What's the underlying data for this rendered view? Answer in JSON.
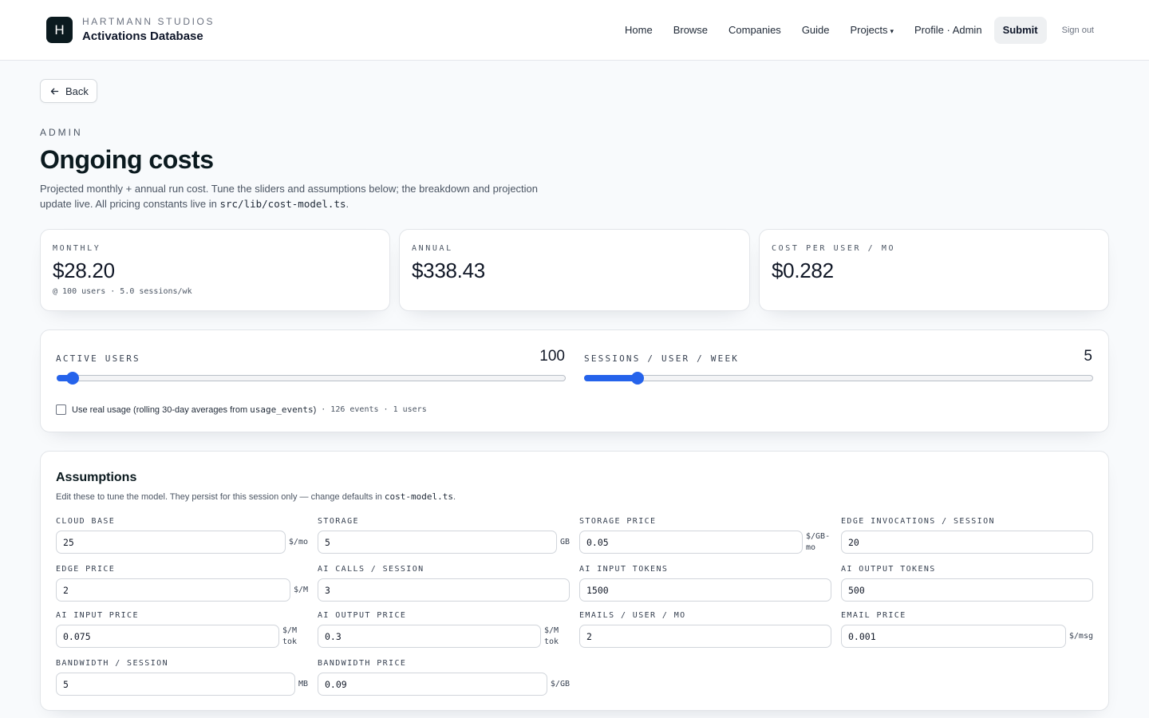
{
  "header": {
    "logo_letter": "H",
    "brand_eyebrow": "HARTMANN STUDIOS",
    "brand_title": "Activations Database",
    "nav": {
      "home": "Home",
      "browse": "Browse",
      "companies": "Companies",
      "guide": "Guide",
      "projects": "Projects",
      "projects_caret": "▾",
      "profile": "Profile · Admin",
      "submit": "Submit",
      "signout": "Sign out"
    }
  },
  "back": {
    "label": "Back"
  },
  "page": {
    "eyebrow": "ADMIN",
    "title": "Ongoing costs",
    "desc_pre": "Projected monthly + annual run cost. Tune the sliders and assumptions below; the breakdown and projection update live. All pricing constants live in ",
    "desc_code": "src/lib/cost-model.ts",
    "desc_post": "."
  },
  "stats": {
    "monthly": {
      "label": "MONTHLY",
      "value": "$28.20",
      "sub": "@ 100 users · 5.0 sessions/wk"
    },
    "annual": {
      "label": "ANNUAL",
      "value": "$338.43"
    },
    "per_user": {
      "label": "COST PER USER / MO",
      "value": "$0.282"
    }
  },
  "sliders": {
    "users": {
      "label": "ACTIVE USERS",
      "value": "100",
      "fraction": 0.017
    },
    "sessions": {
      "label": "SESSIONS / USER / WEEK",
      "value": "5",
      "fraction": 0.093
    },
    "real_usage": {
      "checked": false,
      "label_pre": "Use real usage (rolling 30-day averages from",
      "label_code": "usage_events",
      "label_post": ")",
      "meta": "· 126 events · 1 users"
    }
  },
  "assumptions": {
    "title": "Assumptions",
    "desc_pre": "Edit these to tune the model. They persist for this session only — change defaults in ",
    "desc_code": "cost-model.ts",
    "desc_post": ".",
    "fields": [
      {
        "label": "CLOUD BASE",
        "value": "25",
        "unit": "$/mo"
      },
      {
        "label": "STORAGE",
        "value": "5",
        "unit": "GB"
      },
      {
        "label": "STORAGE PRICE",
        "value": "0.05",
        "unit": "$/GB-mo"
      },
      {
        "label": "EDGE INVOCATIONS / SESSION",
        "value": "20",
        "unit": ""
      },
      {
        "label": "EDGE PRICE",
        "value": "2",
        "unit": "$/M"
      },
      {
        "label": "AI CALLS / SESSION",
        "value": "3",
        "unit": ""
      },
      {
        "label": "AI INPUT TOKENS",
        "value": "1500",
        "unit": ""
      },
      {
        "label": "AI OUTPUT TOKENS",
        "value": "500",
        "unit": ""
      },
      {
        "label": "AI INPUT PRICE",
        "value": "0.075",
        "unit": "$/M tok"
      },
      {
        "label": "AI OUTPUT PRICE",
        "value": "0.3",
        "unit": "$/M tok"
      },
      {
        "label": "EMAILS / USER / MO",
        "value": "2",
        "unit": ""
      },
      {
        "label": "EMAIL PRICE",
        "value": "0.001",
        "unit": "$/msg"
      },
      {
        "label": "BANDWIDTH / SESSION",
        "value": "5",
        "unit": "MB"
      },
      {
        "label": "BANDWIDTH PRICE",
        "value": "0.09",
        "unit": "$/GB"
      }
    ]
  },
  "colors": {
    "accent": "#2563eb",
    "logo_bg": "#0b1a1f",
    "page_bg": "#f8fafc"
  },
  "icons": {
    "back": "arrow-left-icon"
  }
}
